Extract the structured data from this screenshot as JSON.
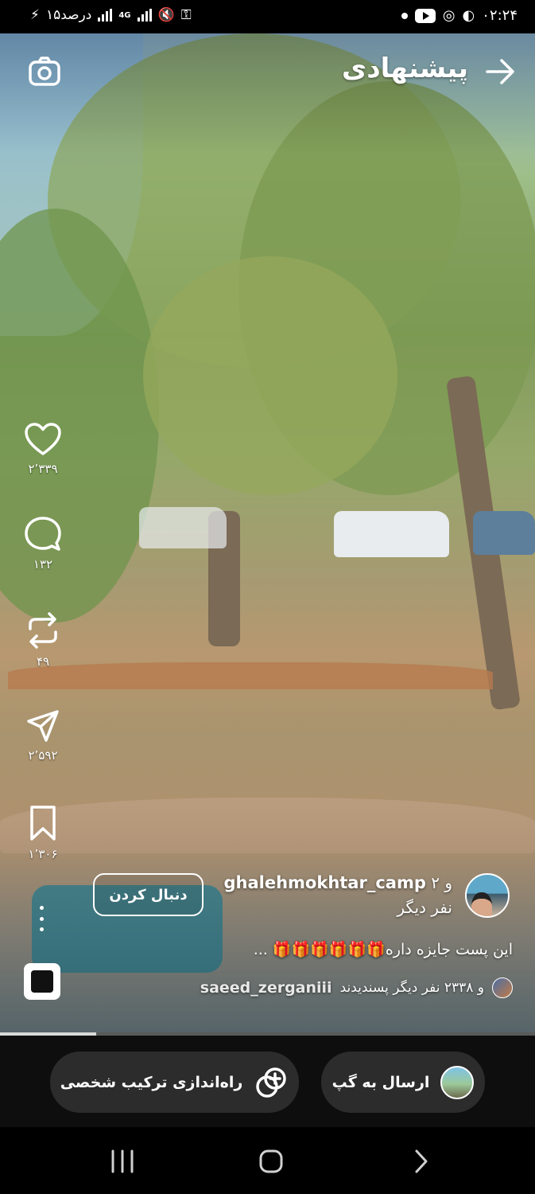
{
  "status_bar": {
    "time": "۰۲:۲۴",
    "battery": "۱۵درصد",
    "network": "4G"
  },
  "header": {
    "title": "پیشنهادی"
  },
  "actions": {
    "likes": "۲٬۳۳۹",
    "comments": "۱۳۲",
    "reposts": "۴۹",
    "shares": "۲٬۵۹۲",
    "saves": "۱٬۳۰۶"
  },
  "post": {
    "author_handle": "ghalehmokhtar_camp",
    "author_prefix": "و ۲",
    "author_suffix": "نفر دیگر",
    "follow_label": "دنبال کردن",
    "caption": "این پست جایزه داره🎁🎁🎁🎁🎁🎁 ...",
    "liked_by_user": "saeed_zerganiii",
    "liked_by_rest": "و ۲۳۳۸ نفر دیگر پسندیدند"
  },
  "progress": {
    "fraction": 0.18
  },
  "bottom_bar": {
    "send_label": "ارسال به گپ",
    "remix_label": "راه‌اندازی ترکیب شخصی"
  },
  "colors": {
    "background": "#000000",
    "pill": "#2c2c2c",
    "text": "#ffffff"
  }
}
